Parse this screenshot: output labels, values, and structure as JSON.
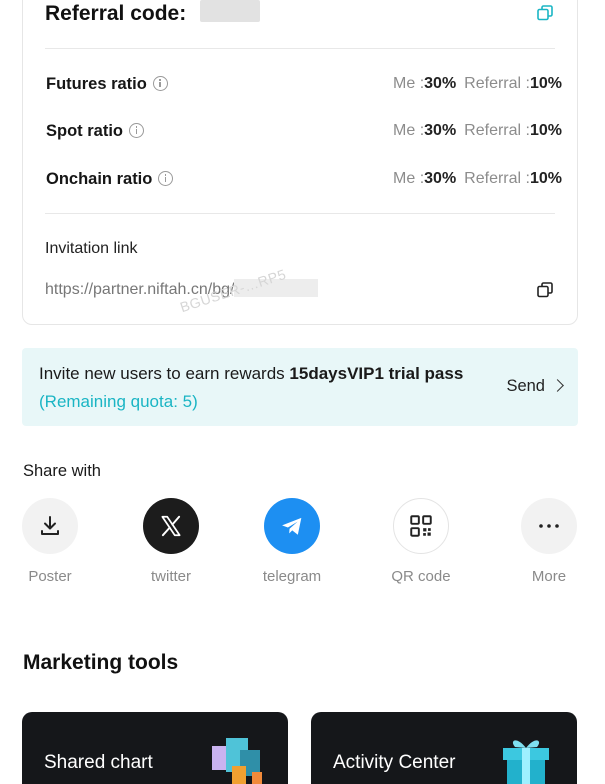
{
  "referral": {
    "title": "Referral code:",
    "ratios": [
      {
        "label": "Futures ratio",
        "me_label": "Me :",
        "me_value": "30%",
        "ref_label": "Referral :",
        "ref_value": "10%"
      },
      {
        "label": "Spot ratio",
        "me_label": "Me :",
        "me_value": "30%",
        "ref_label": "Referral :",
        "ref_value": "10%"
      },
      {
        "label": "Onchain ratio",
        "me_label": "Me :",
        "me_value": "30%",
        "ref_label": "Referral :",
        "ref_value": "10%"
      }
    ],
    "invitation_label": "Invitation link",
    "invitation_url": "https://partner.niftah.cn/bg/",
    "watermark": "BGUSER-…RP5"
  },
  "promo": {
    "text_prefix": "Invite new users to earn rewards ",
    "text_strong": "15daysVIP1 trial pass",
    "text_quota": "(Remaining quota: 5)",
    "send_label": "Send"
  },
  "share": {
    "title": "Share with",
    "items": [
      {
        "label": "Poster",
        "icon": "download-icon"
      },
      {
        "label": "twitter",
        "icon": "x-logo-icon"
      },
      {
        "label": "telegram",
        "icon": "telegram-icon"
      },
      {
        "label": "QR code",
        "icon": "qr-code-icon"
      },
      {
        "label": "More",
        "icon": "more-icon"
      }
    ]
  },
  "marketing": {
    "title": "Marketing tools",
    "tools": [
      {
        "label": "Shared chart",
        "icon": "cubes-icon"
      },
      {
        "label": "Activity Center",
        "icon": "gift-icon"
      }
    ]
  },
  "colors": {
    "accent": "#1ab5c4",
    "promo_bg": "#e8f7f8",
    "telegram": "#1d8ff2",
    "card_dark": "#15171a"
  }
}
